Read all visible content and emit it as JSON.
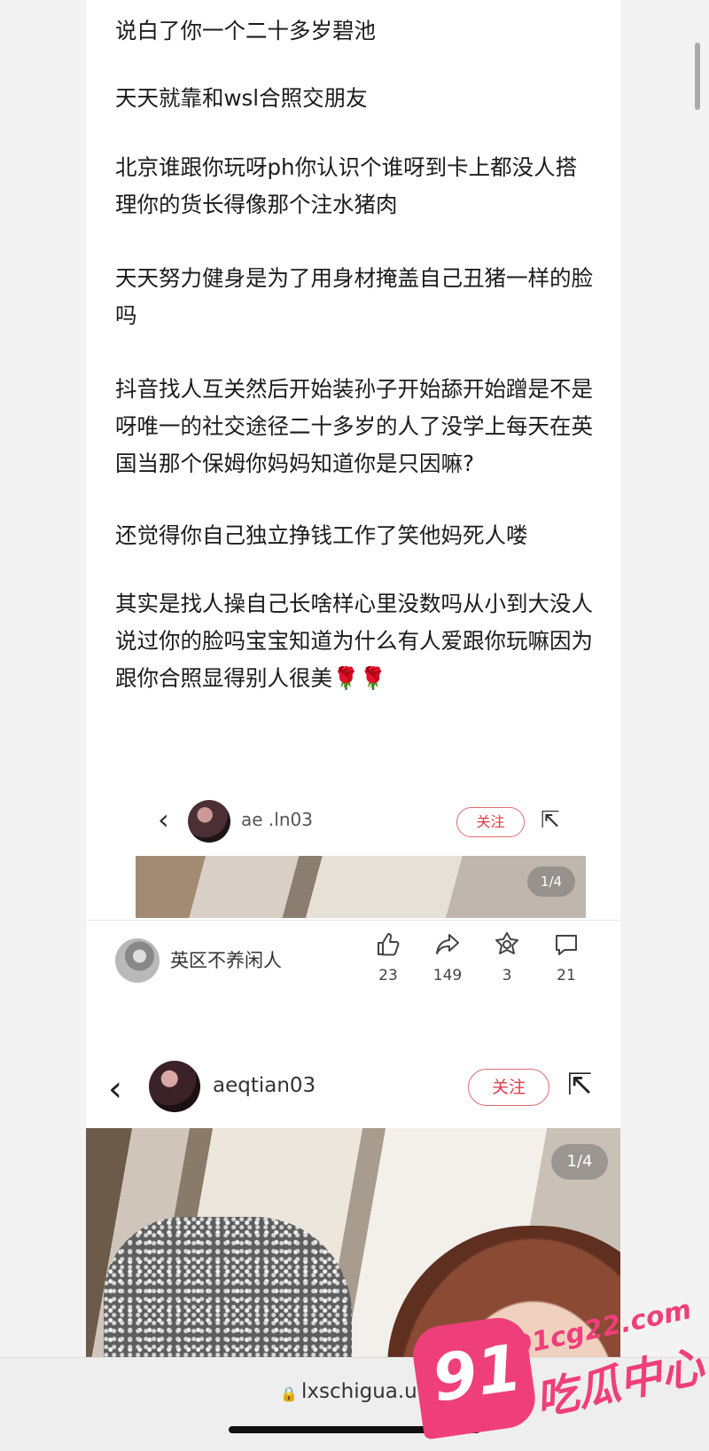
{
  "post": {
    "paragraphs": [
      "说白了你一个二十多岁碧池",
      "天天就靠和wsl合照交朋友",
      "北京谁跟你玩呀ph你认识个谁呀到卡上都没人搭理你的货长得像那个注水猪肉",
      "天天努力健身是为了用身材掩盖自己丑猪一样的脸吗",
      "抖音找人互关然后开始装孙子开始舔开始蹭是不是呀唯一的社交途径二十多岁的人了没学上每天在英国当那个保姆你妈妈知道你是只因嘛?",
      "还觉得你自己独立挣钱工作了笑他妈死人喽",
      "其实是找人操自己长啥样心里没数吗从小到大没人说过你的脸吗宝宝知道为什么有人爱跟你玩嘛因为跟你合照显得别人很美"
    ],
    "last_emoji": "🌹🌹"
  },
  "nested_shot": {
    "username": "ae  .ln03",
    "follow_label": "关注",
    "pager": "1/4"
  },
  "card": {
    "name": "英区不养闲人",
    "stats": [
      {
        "icon": "like-icon",
        "count": "23"
      },
      {
        "icon": "share-icon",
        "count": "149"
      },
      {
        "icon": "collect-icon",
        "count": "3"
      },
      {
        "icon": "comment-icon",
        "count": "21"
      }
    ]
  },
  "big_shot": {
    "username": "aeqtian03",
    "follow_label": "关注",
    "pager": "1/4"
  },
  "browser": {
    "url": "lxschigua.uk"
  },
  "watermark": {
    "badge": "91",
    "domain": "91cg22.com",
    "text": "吃瓜中心"
  }
}
